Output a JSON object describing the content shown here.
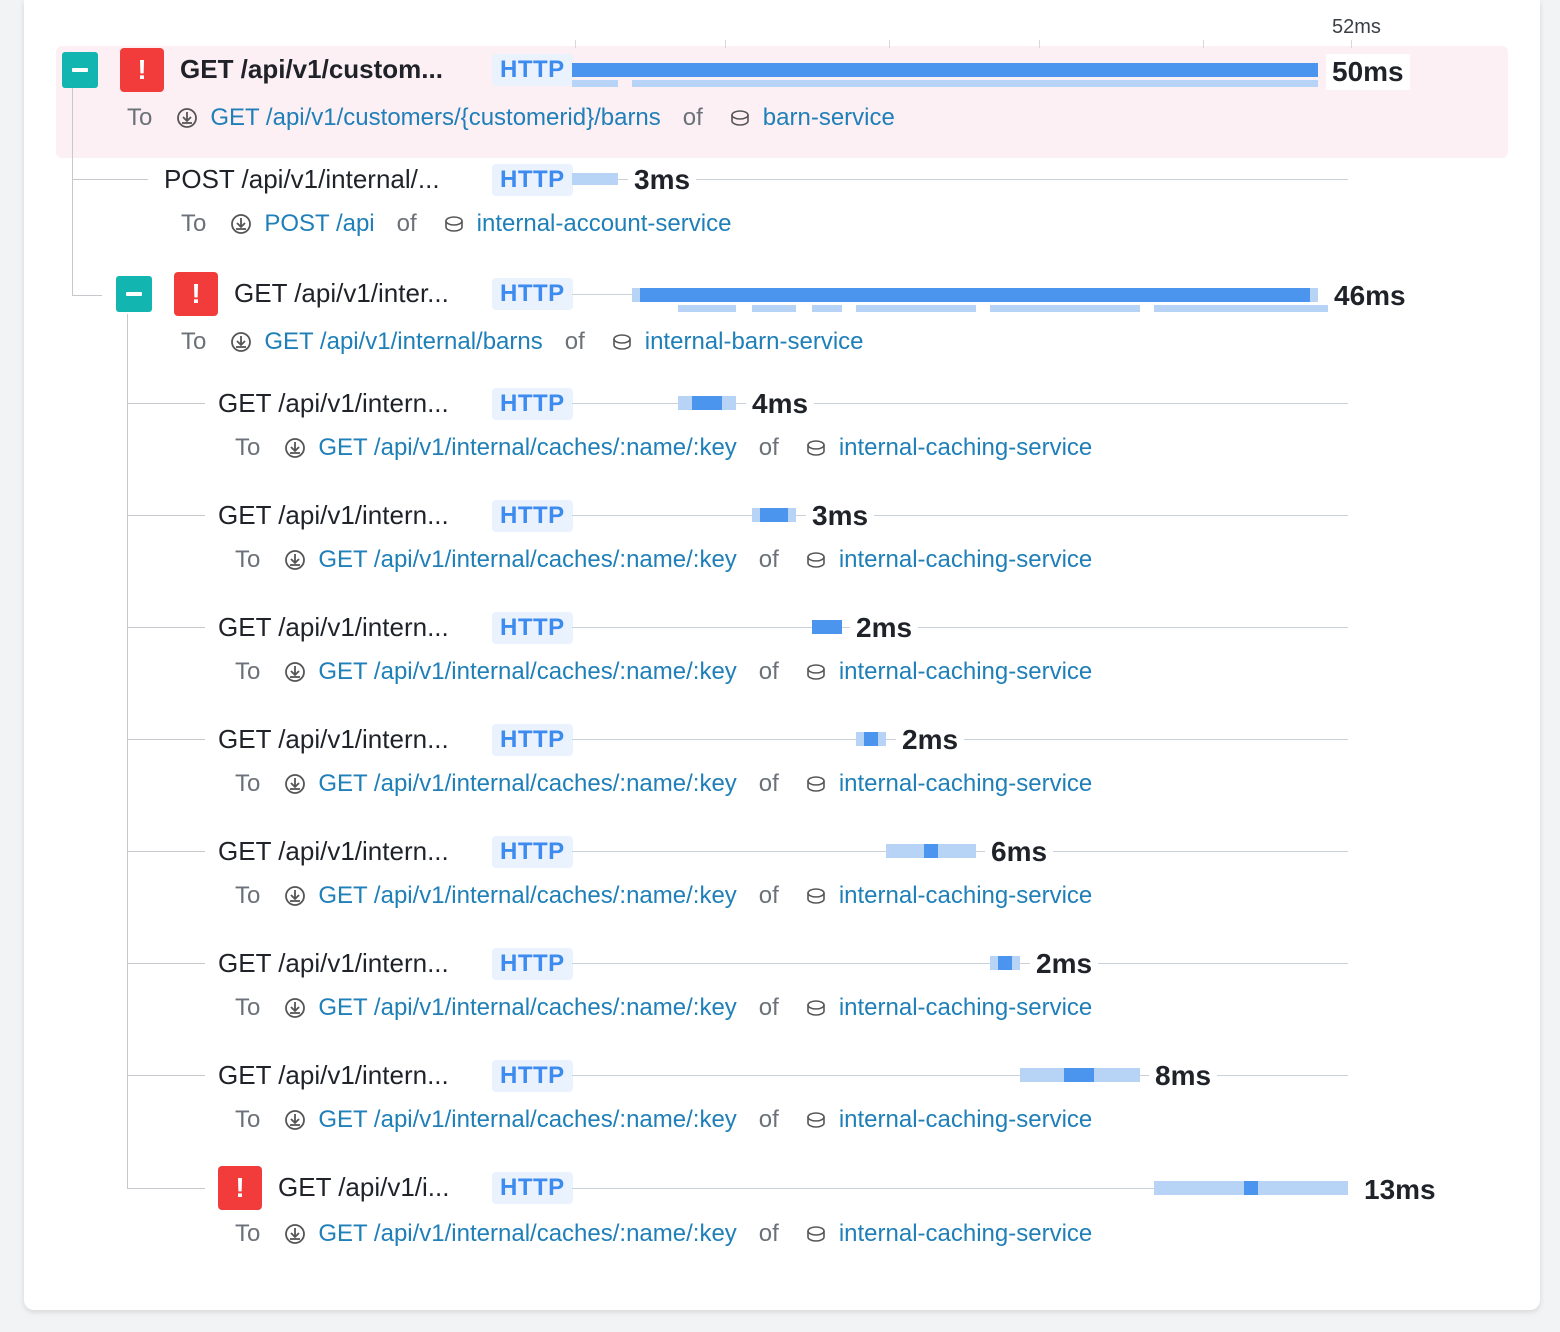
{
  "timeline": {
    "max_label": "52ms",
    "max_ms": 52
  },
  "rows": [
    {
      "title": "GET /api/v1/custom...",
      "protocol": "HTTP",
      "duration": "50ms",
      "error": true,
      "collapsible": true,
      "detail": {
        "to": "To",
        "endpoint": "GET /api/v1/customers/{customerid}/barns",
        "of": "of",
        "service": "barn-service"
      }
    },
    {
      "title": "POST /api/v1/internal/...",
      "protocol": "HTTP",
      "duration": "3ms",
      "error": false,
      "collapsible": false,
      "detail": {
        "to": "To",
        "endpoint": "POST /api",
        "of": "of",
        "service": "internal-account-service"
      }
    },
    {
      "title": "GET /api/v1/inter...",
      "protocol": "HTTP",
      "duration": "46ms",
      "error": true,
      "collapsible": true,
      "detail": {
        "to": "To",
        "endpoint": "GET /api/v1/internal/barns",
        "of": "of",
        "service": "internal-barn-service"
      }
    },
    {
      "title": "GET /api/v1/intern...",
      "protocol": "HTTP",
      "duration": "4ms",
      "error": false,
      "collapsible": false,
      "detail": {
        "to": "To",
        "endpoint": "GET /api/v1/internal/caches/:name/:key",
        "of": "of",
        "service": "internal-caching-service"
      }
    },
    {
      "title": "GET /api/v1/intern...",
      "protocol": "HTTP",
      "duration": "3ms",
      "error": false,
      "collapsible": false,
      "detail": {
        "to": "To",
        "endpoint": "GET /api/v1/internal/caches/:name/:key",
        "of": "of",
        "service": "internal-caching-service"
      }
    },
    {
      "title": "GET /api/v1/intern...",
      "protocol": "HTTP",
      "duration": "2ms",
      "error": false,
      "collapsible": false,
      "detail": {
        "to": "To",
        "endpoint": "GET /api/v1/internal/caches/:name/:key",
        "of": "of",
        "service": "internal-caching-service"
      }
    },
    {
      "title": "GET /api/v1/intern...",
      "protocol": "HTTP",
      "duration": "2ms",
      "error": false,
      "collapsible": false,
      "detail": {
        "to": "To",
        "endpoint": "GET /api/v1/internal/caches/:name/:key",
        "of": "of",
        "service": "internal-caching-service"
      }
    },
    {
      "title": "GET /api/v1/intern...",
      "protocol": "HTTP",
      "duration": "6ms",
      "error": false,
      "collapsible": false,
      "detail": {
        "to": "To",
        "endpoint": "GET /api/v1/internal/caches/:name/:key",
        "of": "of",
        "service": "internal-caching-service"
      }
    },
    {
      "title": "GET /api/v1/intern...",
      "protocol": "HTTP",
      "duration": "2ms",
      "error": false,
      "collapsible": false,
      "detail": {
        "to": "To",
        "endpoint": "GET /api/v1/internal/caches/:name/:key",
        "of": "of",
        "service": "internal-caching-service"
      }
    },
    {
      "title": "GET /api/v1/intern...",
      "protocol": "HTTP",
      "duration": "8ms",
      "error": false,
      "collapsible": false,
      "detail": {
        "to": "To",
        "endpoint": "GET /api/v1/internal/caches/:name/:key",
        "of": "of",
        "service": "internal-caching-service"
      }
    },
    {
      "title": "GET /api/v1/i...",
      "protocol": "HTTP",
      "duration": "13ms",
      "error": true,
      "collapsible": false,
      "detail": {
        "to": "To",
        "endpoint": "GET /api/v1/internal/caches/:name/:key",
        "of": "of",
        "service": "internal-caching-service"
      }
    }
  ],
  "icons": {
    "collapse": "minus-icon",
    "error": "exclamation-icon",
    "endpoint": "endpoint-icon",
    "service": "database-icon"
  },
  "colors": {
    "error": "#f23c3c",
    "toggle": "#12b5b0",
    "bar": "#4c95ef",
    "bar_light": "#b7d4f7",
    "link": "#1f7fb8",
    "badge": "#3d8bef",
    "highlight": "#fdf0f4"
  }
}
